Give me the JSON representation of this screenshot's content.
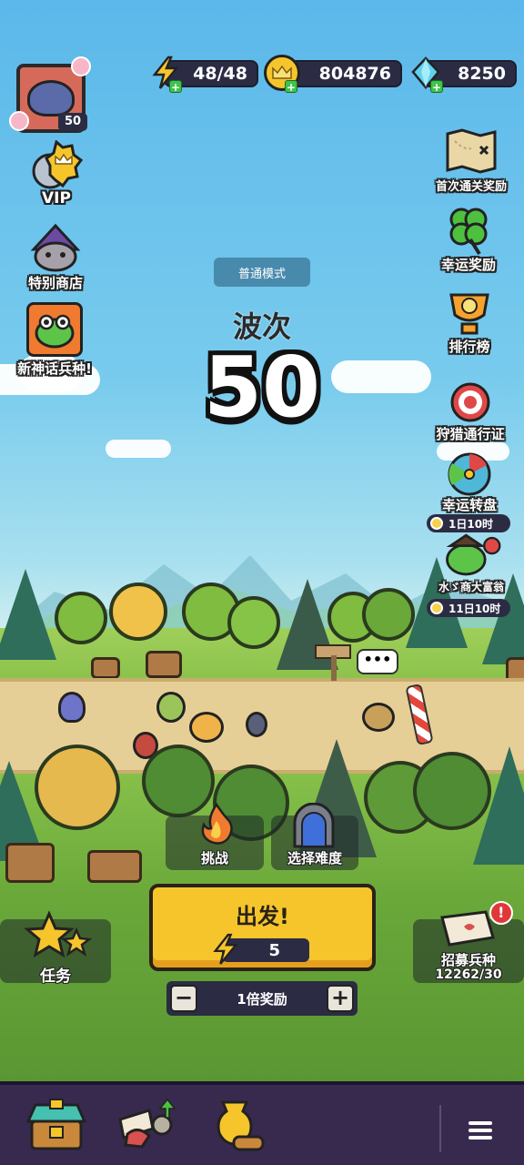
{
  "currency": {
    "energy": "48/48",
    "coins": "804876",
    "gems": "8250"
  },
  "player": {
    "level": "50"
  },
  "left_menu": {
    "vip": "VIP",
    "special_shop": "特别商店",
    "new_hero": "新神话兵种!"
  },
  "right_menu": {
    "first_clear": "首次通关奖励",
    "lucky_reward": "幸运奖励",
    "ranking": "排行榜",
    "hunting_pass": "狩猎通行证",
    "lucky_wheel": "幸运转盘",
    "lucky_wheel_timer": "1日10时",
    "merchant": "水ゞ商大富翁",
    "merchant_timer": "11日10时"
  },
  "stage": {
    "mode": "普通模式",
    "wave_label": "波次",
    "wave_number": "50"
  },
  "actions": {
    "challenge": "挑战",
    "select_difficulty": "选择难度",
    "go": "出发!",
    "go_cost": "5",
    "multiplier": "1倍奖励",
    "quests": "任务",
    "recruit": "招募兵种",
    "recruit_count": "12262/30"
  },
  "colors": {
    "accent_yellow": "#f6c52c",
    "panel_dark": "#2b2c44",
    "nav_purple": "#382a4e"
  },
  "icons": {
    "energy": "lightning-icon",
    "coins": "crown-coin-icon",
    "gems": "diamond-icon",
    "menu": "hamburger-menu-icon"
  }
}
